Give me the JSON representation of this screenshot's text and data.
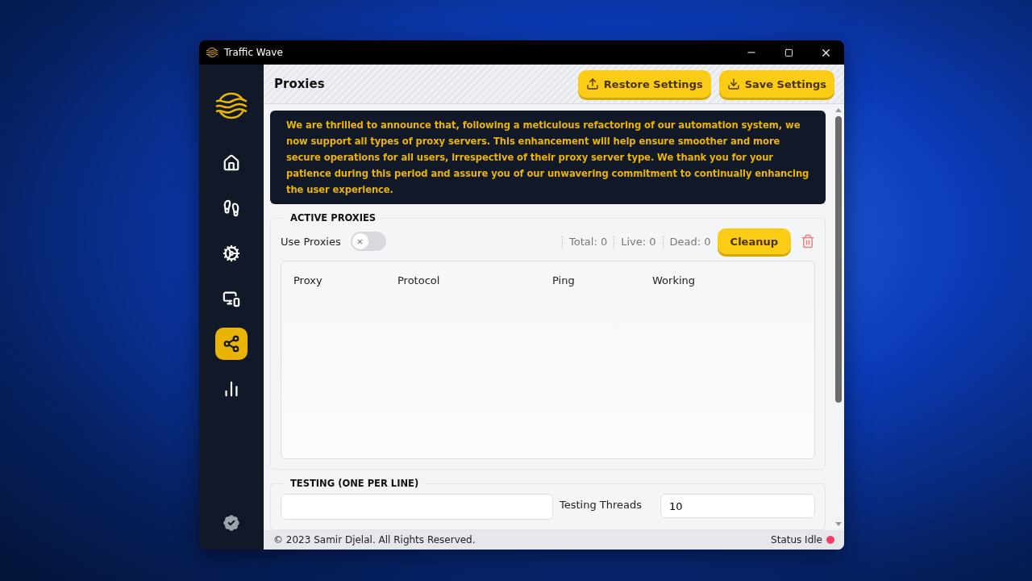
{
  "window": {
    "title": "Traffic Wave"
  },
  "sidebar": {
    "items": [
      {
        "kind": "home",
        "selected": false
      },
      {
        "kind": "steps",
        "selected": false
      },
      {
        "kind": "gears",
        "selected": false
      },
      {
        "kind": "devices",
        "selected": false
      },
      {
        "kind": "network",
        "selected": true
      },
      {
        "kind": "signal",
        "selected": false
      }
    ]
  },
  "header": {
    "title": "Proxies",
    "buttons": [
      {
        "label": "Restore Settings",
        "kind": "upload"
      },
      {
        "label": "Save Settings",
        "kind": "download"
      }
    ]
  },
  "notice": "We are thrilled to announce that, following a meticulous refactoring of our automation system, we now support all types of proxy servers. This enhancement will help ensure smoother and more secure operations for all users, irrespective of their proxy server type. We thank you for your patience during this period and assure you of our unwavering commitment to continually enhancing the user experience.",
  "active_proxies": {
    "legend": "ACTIVE PROXIES",
    "toggle": {
      "label": "Use Proxies",
      "on": false
    },
    "stats": [
      "Total: 0",
      "Live: 0",
      "Dead: 0"
    ],
    "cleanup": "Cleanup",
    "table": {
      "columns": [
        "Proxy",
        "Protocol",
        "Ping",
        "Working"
      ]
    }
  },
  "testing": {
    "legend": "TESTING (ONE PER LINE)",
    "threads_label": "Testing Threads",
    "threads_value": "10"
  },
  "status_bar": {
    "copyright": "© 2023 Samir Djelal. All Rights Reserved.",
    "status": "Status Idle",
    "color": "#f43f5e"
  }
}
